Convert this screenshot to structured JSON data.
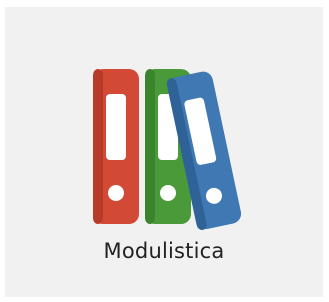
{
  "tile": {
    "label": "Modulistica",
    "icon": "binders-icon",
    "background": "#f1f1f1"
  },
  "binders": [
    {
      "name": "red-binder",
      "color": "#d24a36",
      "shade": "#b83a28"
    },
    {
      "name": "green-binder",
      "color": "#4a9a3a",
      "shade": "#3a842c"
    },
    {
      "name": "blue-binder",
      "color": "#3f78b3",
      "shade": "#2f6398"
    }
  ]
}
